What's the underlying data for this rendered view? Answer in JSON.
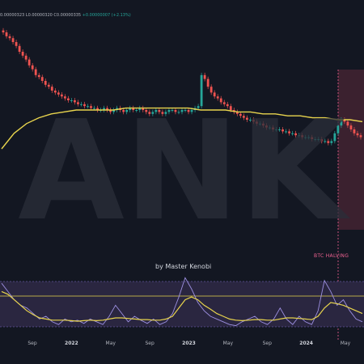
{
  "header": {
    "ohlc_text": "0.00000323  L0.00000320  C0.00000335",
    "change_text": "+0.00000007 (+2.13%)"
  },
  "watermark": {
    "text": "ANK"
  },
  "halving": {
    "label": "BTC HALVING"
  },
  "author": {
    "text": "by Master Kenobi"
  },
  "colors": {
    "background": "#131722",
    "up_candle": "#26a69a",
    "down_candle": "#ef5350",
    "moving_average": "#e8d44d",
    "oscillator": "#9c8fe0",
    "oscillator_band": "#2a2640",
    "halving_zone": "#5c2a3a",
    "halving_line": "#f06292",
    "watermark": "#2a2e39"
  },
  "chart_data": [
    {
      "type": "candlestick",
      "title": "",
      "x_tick_labels": [
        "Sep",
        "2022",
        "May",
        "Sep",
        "2023",
        "May",
        "Sep",
        "2024",
        "May"
      ],
      "bold_ticks": [
        "2022",
        "2023",
        "2024"
      ],
      "grid": false,
      "annotations": [
        "BTC HALVING"
      ],
      "candles_close_trend_relative": [
        1.0,
        0.98,
        0.97,
        0.95,
        0.93,
        0.9,
        0.88,
        0.86,
        0.83,
        0.81,
        0.78,
        0.77,
        0.75,
        0.73,
        0.72,
        0.7,
        0.69,
        0.68,
        0.67,
        0.66,
        0.65,
        0.65,
        0.64,
        0.63,
        0.63,
        0.62,
        0.62,
        0.61,
        0.61,
        0.6,
        0.6,
        0.61,
        0.6,
        0.59,
        0.6,
        0.61,
        0.6,
        0.59,
        0.6,
        0.61,
        0.6,
        0.6,
        0.61,
        0.6,
        0.59,
        0.58,
        0.59,
        0.6,
        0.59,
        0.58,
        0.59,
        0.6,
        0.6,
        0.59,
        0.59,
        0.6,
        0.6,
        0.59,
        0.6,
        0.61,
        0.62,
        0.78,
        0.76,
        0.72,
        0.69,
        0.67,
        0.66,
        0.64,
        0.63,
        0.62,
        0.6,
        0.59,
        0.58,
        0.57,
        0.56,
        0.55,
        0.55,
        0.54,
        0.53,
        0.53,
        0.52,
        0.51,
        0.51,
        0.5,
        0.5,
        0.5,
        0.49,
        0.49,
        0.48,
        0.48,
        0.47,
        0.47,
        0.46,
        0.46,
        0.46,
        0.45,
        0.45,
        0.45,
        0.44,
        0.44,
        0.43,
        0.44,
        0.48,
        0.52,
        0.55,
        0.54,
        0.52,
        0.5,
        0.48,
        0.47,
        0.46
      ],
      "moving_average_trend_relative": [
        0.4,
        0.48,
        0.53,
        0.56,
        0.58,
        0.59,
        0.6,
        0.6,
        0.6,
        0.6,
        0.61,
        0.61,
        0.61,
        0.61,
        0.61,
        0.61,
        0.6,
        0.6,
        0.6,
        0.59,
        0.59,
        0.58,
        0.58,
        0.57,
        0.57,
        0.56,
        0.56,
        0.55,
        0.55,
        0.54
      ]
    },
    {
      "type": "line",
      "title": "",
      "series": [
        {
          "values": [
            0.85,
            0.7,
            0.55,
            0.45,
            0.4,
            0.3,
            0.2,
            0.25,
            0.15,
            0.1,
            0.2,
            0.15,
            0.18,
            0.12,
            0.2,
            0.15,
            0.1,
            0.25,
            0.45,
            0.3,
            0.15,
            0.25,
            0.18,
            0.12,
            0.2,
            0.1,
            0.15,
            0.3,
            0.6,
            0.95,
            0.75,
            0.5,
            0.35,
            0.25,
            0.2,
            0.15,
            0.1,
            0.08,
            0.15,
            0.2,
            0.25,
            0.15,
            0.1,
            0.2,
            0.4,
            0.2,
            0.1,
            0.25,
            0.15,
            0.1,
            0.35,
            0.9,
            0.7,
            0.45,
            0.55,
            0.35,
            0.2,
            0.15
          ]
        },
        {
          "values": [
            0.7,
            0.65,
            0.55,
            0.45,
            0.35,
            0.28,
            0.22,
            0.2,
            0.18,
            0.18,
            0.18,
            0.17,
            0.16,
            0.17,
            0.18,
            0.17,
            0.18,
            0.2,
            0.22,
            0.22,
            0.21,
            0.2,
            0.19,
            0.19,
            0.18,
            0.18,
            0.2,
            0.25,
            0.4,
            0.55,
            0.6,
            0.55,
            0.45,
            0.38,
            0.3,
            0.25,
            0.2,
            0.18,
            0.17,
            0.18,
            0.19,
            0.19,
            0.18,
            0.18,
            0.2,
            0.22,
            0.22,
            0.21,
            0.2,
            0.19,
            0.25,
            0.4,
            0.5,
            0.48,
            0.45,
            0.4,
            0.35,
            0.3
          ]
        }
      ],
      "reference_lines": [
        "upper",
        "middle"
      ]
    }
  ]
}
